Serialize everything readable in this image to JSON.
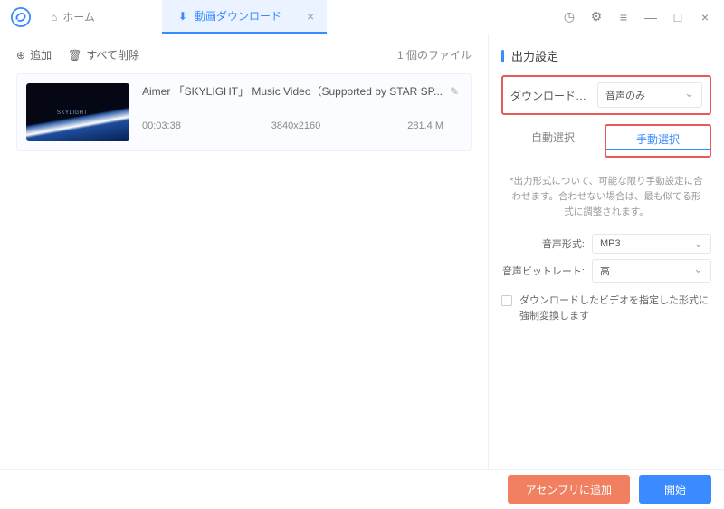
{
  "tabs": {
    "home": "ホーム",
    "download": "動画ダウンロード"
  },
  "toolbar": {
    "add": "追加",
    "delete_all": "すべて削除",
    "file_count": "1 個のファイル"
  },
  "item": {
    "title": "Aimer 「SKYLIGHT」 Music Video（Supported by STAR SP...",
    "duration": "00:03:38",
    "resolution": "3840x2160",
    "size": "281.4 M"
  },
  "output": {
    "section_title": "出力設定",
    "download_setting_label": "ダウンロード設...",
    "download_setting_value": "音声のみ",
    "tab_auto": "自動選択",
    "tab_manual": "手動選択",
    "note": "*出力形式について、可能な限り手動設定に合わせます。合わせない場合は、最も似てる形式に調整されます。",
    "audio_format_label": "音声形式:",
    "audio_format_value": "MP3",
    "audio_bitrate_label": "音声ビットレート:",
    "audio_bitrate_value": "高",
    "checkbox_label": "ダウンロードしたビデオを指定した形式に強制変換します"
  },
  "footer": {
    "add_to_assembly": "アセンブリに追加",
    "start": "開始"
  }
}
